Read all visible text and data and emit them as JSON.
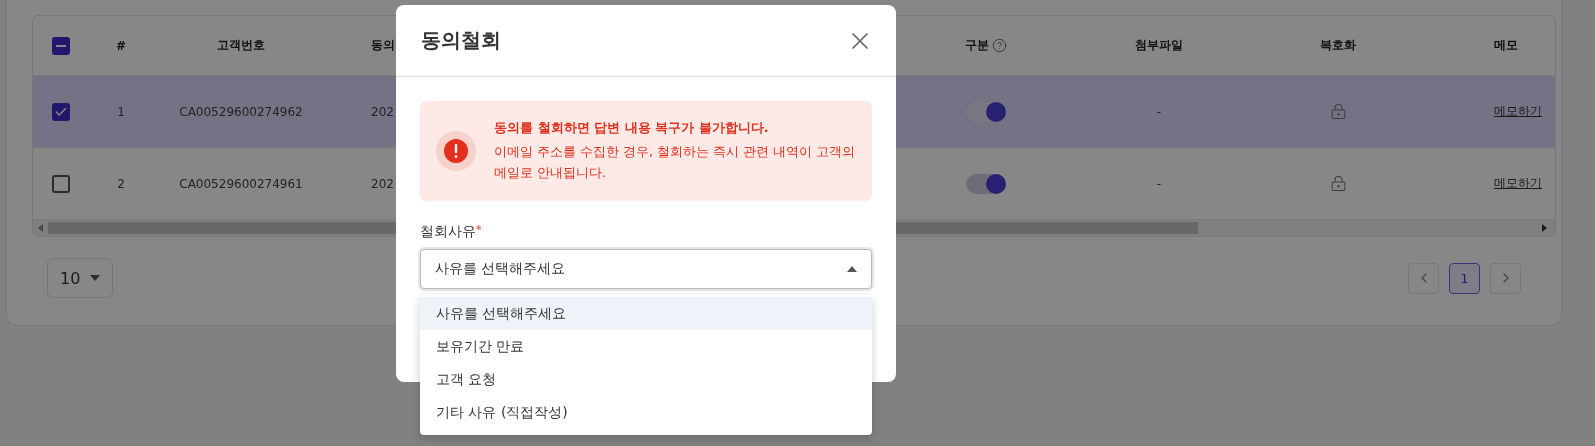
{
  "table": {
    "header_checkbox": {
      "indeterminate": true
    },
    "columns": [
      {
        "label": "#"
      },
      {
        "label": "고객번호"
      },
      {
        "label": "동의"
      },
      {
        "label": "구분",
        "help": true
      },
      {
        "label": "첨부파일"
      },
      {
        "label": "복호화"
      },
      {
        "label": "메모"
      }
    ],
    "rows": [
      {
        "selected": true,
        "checked": true,
        "number": "1",
        "customer_id": "CA00529600274962",
        "column_4": "202",
        "toggle_on": true,
        "attachment": "-",
        "memo": "메모하기"
      },
      {
        "selected": false,
        "checked": false,
        "number": "2",
        "customer_id": "CA00529600274961",
        "column_4": "202",
        "toggle_on": true,
        "attachment": "-",
        "memo": "메모하기"
      }
    ]
  },
  "pagination": {
    "page_size": "10",
    "pages": [
      {
        "label": "1",
        "selected": true
      }
    ]
  },
  "dialog": {
    "title": "동의철회",
    "alert": {
      "title": "동의를 철회하면 답변 내용 복구가 불가합니다.",
      "message": "이메일 주소를 수집한 경우, 철회하는 즉시 관련 내역이 고객의 메일로 안내됩니다."
    },
    "field": {
      "label": "철회사유",
      "required_mark": "*",
      "value": "사유를 선택해주세요",
      "expanded": true,
      "options": [
        {
          "label": "사유를 선택해주세요",
          "selected": true
        },
        {
          "label": "보유기간 만료",
          "selected": false
        },
        {
          "label": "고객 요청",
          "selected": false
        },
        {
          "label": "기타 사유 (직접작성)",
          "selected": false
        }
      ]
    }
  }
}
